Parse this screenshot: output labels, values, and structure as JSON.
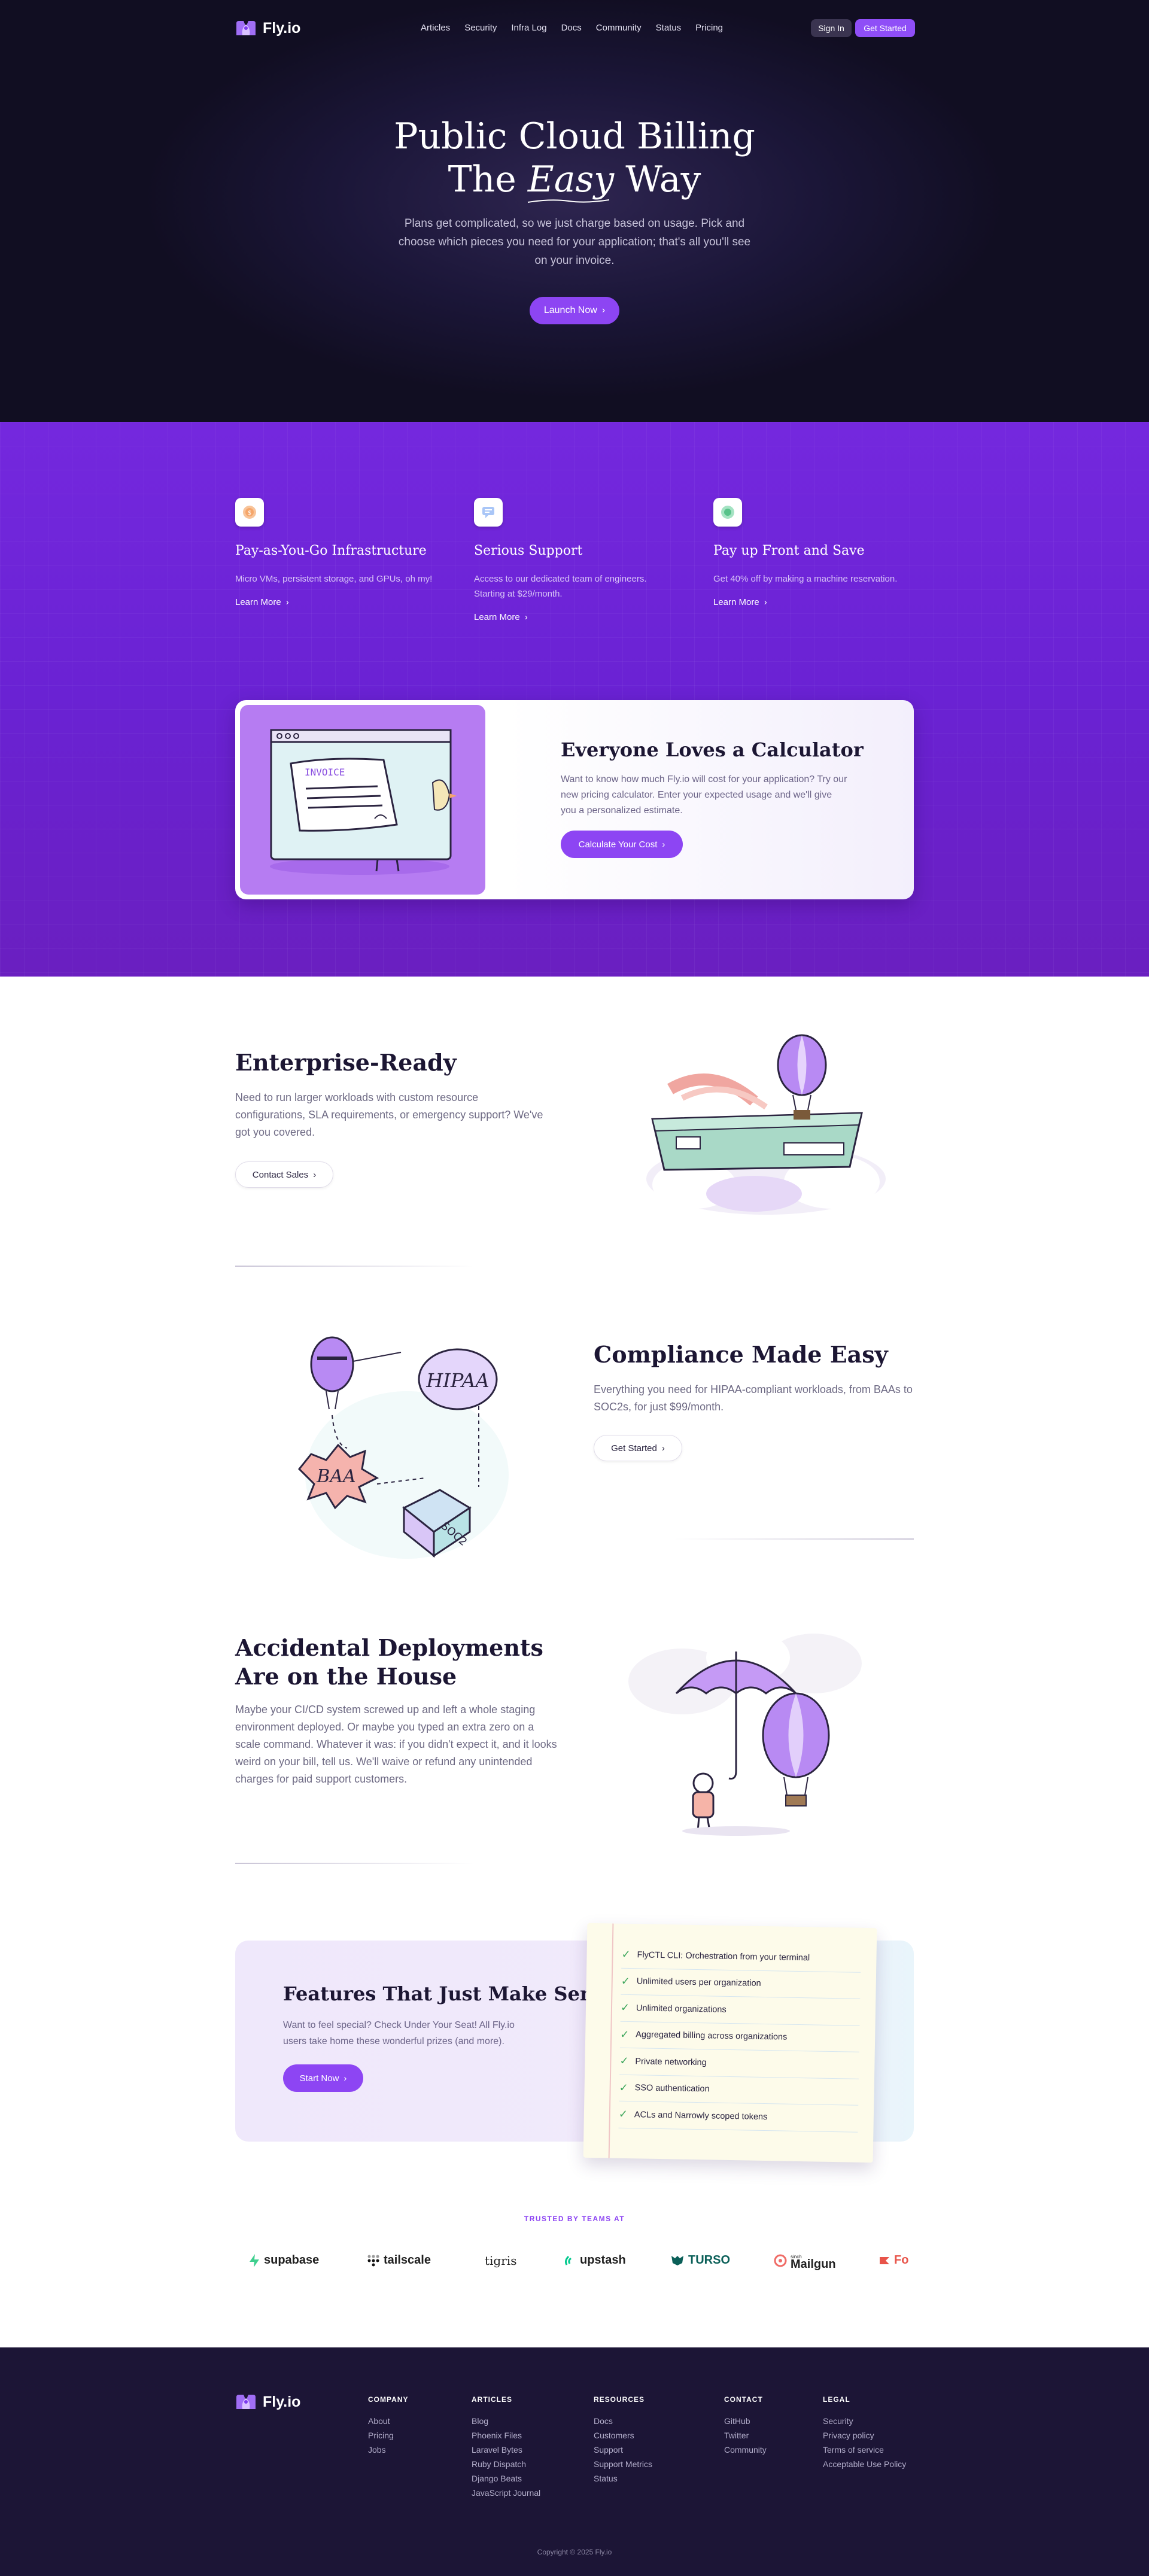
{
  "nav": {
    "brand": "Fly.io",
    "links": [
      "Articles",
      "Security",
      "Infra Log",
      "Docs",
      "Community",
      "Status",
      "Pricing"
    ],
    "sign_in": "Sign In",
    "get_started": "Get Started"
  },
  "hero": {
    "title_line1": "Public Cloud Billing",
    "title_the": "The",
    "title_easy": "Easy",
    "title_way": "Way",
    "description": "Plans get complicated, so we just charge based on usage. Pick and choose which pieces you need for your application; that's all you'll see on your invoice.",
    "cta": "Launch Now"
  },
  "features": [
    {
      "title": "Pay-as-You-Go Infrastructure",
      "description": "Micro VMs, persistent storage, and GPUs, oh my!",
      "link": "Learn More",
      "icon": "coin-icon",
      "icon_color": "#f5a66a"
    },
    {
      "title": "Serious Support",
      "description": "Access to our dedicated team of engineers. Starting at $29/month.",
      "link": "Learn More",
      "icon": "chat-icon",
      "icon_color": "#7aa7f0"
    },
    {
      "title": "Pay up Front and Save",
      "description": "Get 40% off by making a machine reservation.",
      "link": "Learn More",
      "icon": "savings-icon",
      "icon_color": "#58c28a"
    }
  ],
  "calculator": {
    "invoice_word": "INVOICE",
    "title": "Everyone Loves a Calculator",
    "description": "Want to know how much Fly.io will cost for your application? Try our new pricing calculator. Enter your expected usage and we'll give you a personalized estimate.",
    "cta": "Calculate Your Cost"
  },
  "enterprise": {
    "title": "Enterprise-Ready",
    "description": "Need to run larger workloads with custom resource configurations, SLA requirements, or emergency support? We've got you covered.",
    "cta": "Contact Sales"
  },
  "compliance": {
    "title": "Compliance Made Easy",
    "description": "Everything you need for HIPAA-compliant workloads, from BAAs to SOC2s, for just $99/month.",
    "cta": "Get Started",
    "illus_hipaa": "HIPAA",
    "illus_baa": "BAA",
    "illus_soc2": "SOC2"
  },
  "accidental": {
    "title_line1": "Accidental Deployments",
    "title_line2": "Are on the House",
    "description": "Maybe your CI/CD system screwed up and left a whole staging environment deployed. Or maybe you typed an extra zero on a scale command. Whatever it was: if you didn't expect it, and it looks weird on your bill, tell us. We'll waive or refund any unintended charges for paid support customers."
  },
  "perks": {
    "title": "Features That Just Make Sense",
    "description": "Want to feel special? Check Under Your Seat! All Fly.io users take home these wonderful prizes (and more).",
    "cta": "Start Now",
    "items": [
      "FlyCTL CLI: Orchestration from your terminal",
      "Unlimited users per organization",
      "Unlimited organizations",
      "Aggregated billing across organizations",
      "Private networking",
      "SSO authentication",
      "ACLs and Narrowly scoped tokens"
    ]
  },
  "trusted": {
    "heading": "TRUSTED BY TEAMS AT",
    "logos": [
      "supabase",
      "tailscale",
      "tigris",
      "upstash",
      "TURSO",
      "Mailgun",
      "Fo"
    ],
    "mailgun_prefix": "sinch"
  },
  "footer": {
    "brand": "Fly.io",
    "columns": [
      {
        "heading": "COMPANY",
        "links": [
          "About",
          "Pricing",
          "Jobs"
        ]
      },
      {
        "heading": "ARTICLES",
        "links": [
          "Blog",
          "Phoenix Files",
          "Laravel Bytes",
          "Ruby Dispatch",
          "Django Beats",
          "JavaScript Journal"
        ]
      },
      {
        "heading": "RESOURCES",
        "links": [
          "Docs",
          "Customers",
          "Support",
          "Support Metrics",
          "Status"
        ]
      },
      {
        "heading": "CONTACT",
        "links": [
          "GitHub",
          "Twitter",
          "Community"
        ]
      },
      {
        "heading": "LEGAL",
        "links": [
          "Security",
          "Privacy policy",
          "Terms of service",
          "Acceptable Use Policy"
        ]
      }
    ],
    "copyright": "Copyright © 2025 Fly.io"
  },
  "colors": {
    "accent": "#8d45f3",
    "hero_bg": "#151129",
    "purple_section": "#6a22d3",
    "footer_bg": "#1c1536"
  }
}
